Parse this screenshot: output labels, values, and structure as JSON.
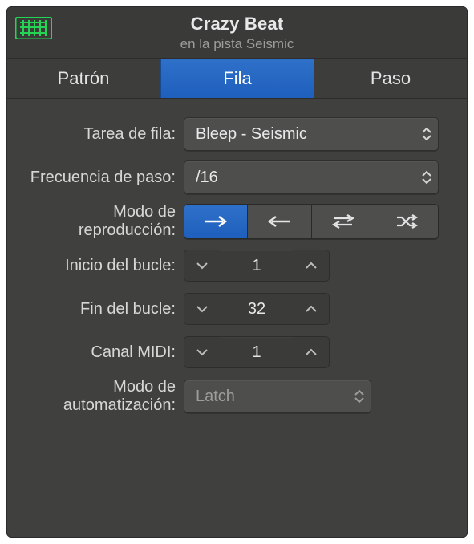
{
  "header": {
    "title": "Crazy Beat",
    "subtitle": "en la pista Seismic"
  },
  "tabs": {
    "pattern": "Patrón",
    "row": "Fila",
    "step": "Paso",
    "active": "row"
  },
  "labels": {
    "row_task": "Tarea de fila:",
    "step_rate": "Frecuencia de paso:",
    "play_mode": "Modo de reproducción:",
    "loop_start": "Inicio del bucle:",
    "loop_end": "Fin del bucle:",
    "midi_channel": "Canal MIDI:",
    "automation_mode": "Modo de automatización:"
  },
  "values": {
    "row_task": "Bleep - Seismic",
    "step_rate": "/16",
    "loop_start": "1",
    "loop_end": "32",
    "midi_channel": "1",
    "automation_mode": "Latch"
  },
  "playback_mode": {
    "options": [
      "forward",
      "backward",
      "pingpong",
      "random"
    ],
    "active": "forward"
  },
  "colors": {
    "accent": "#2268c7"
  }
}
